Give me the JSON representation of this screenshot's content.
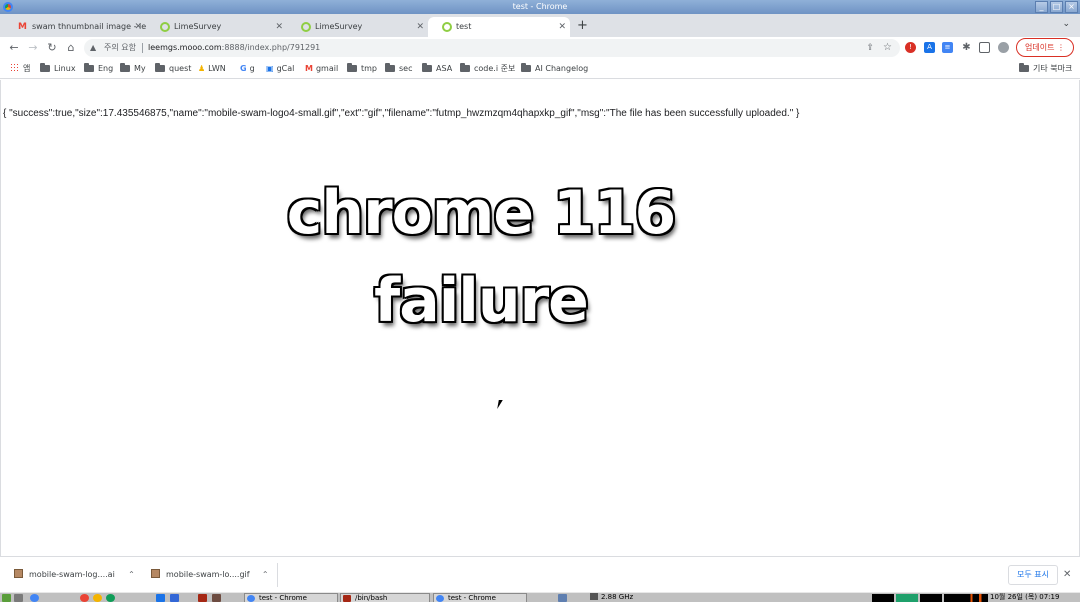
{
  "window": {
    "title": "test - Chrome"
  },
  "tabs": [
    {
      "title": "swam thnumbnail image - lee",
      "icon": "gmail-icon"
    },
    {
      "title": "LimeSurvey",
      "icon": "limesurvey-icon"
    },
    {
      "title": "LimeSurvey",
      "icon": "limesurvey-icon"
    },
    {
      "title": "test",
      "icon": "limesurvey-icon"
    }
  ],
  "toolbar": {
    "security_warning": "주의 요함",
    "url_host": "leemgs.mooo.com",
    "url_path": ":8888/index.php/791291",
    "update_label": "업데이트"
  },
  "bookmarks": {
    "apps": "앱",
    "items": [
      "Linux",
      "Eng",
      "My",
      "quest",
      "LWN",
      "g",
      "gCal",
      "gmail",
      "tmp",
      "sec",
      "ASA",
      "code.i 준보",
      "AI Changelog"
    ],
    "other": "기타 북마크"
  },
  "page": {
    "json_response": "{ \"success\":true,\"size\":17.435546875,\"name\":\"mobile-swam-logo4-small.gif\",\"ext\":\"gif\",\"filename\":\"futmp_hwzmzqm4qhapxkp_gif\",\"msg\":\"The file has been successfully uploaded.\" }",
    "overlay_line1": "chrome 116",
    "overlay_line2": "failure"
  },
  "downloads": {
    "items": [
      "mobile-swam-log....ai",
      "mobile-swam-lo....gif"
    ],
    "show_all": "모두 표시"
  },
  "taskbar": {
    "tasks": [
      "test - Chrome",
      "/bin/bash",
      "test - Chrome"
    ],
    "cpu": "2.88 GHz",
    "clock": "10월 26일 (목) 07:19"
  }
}
